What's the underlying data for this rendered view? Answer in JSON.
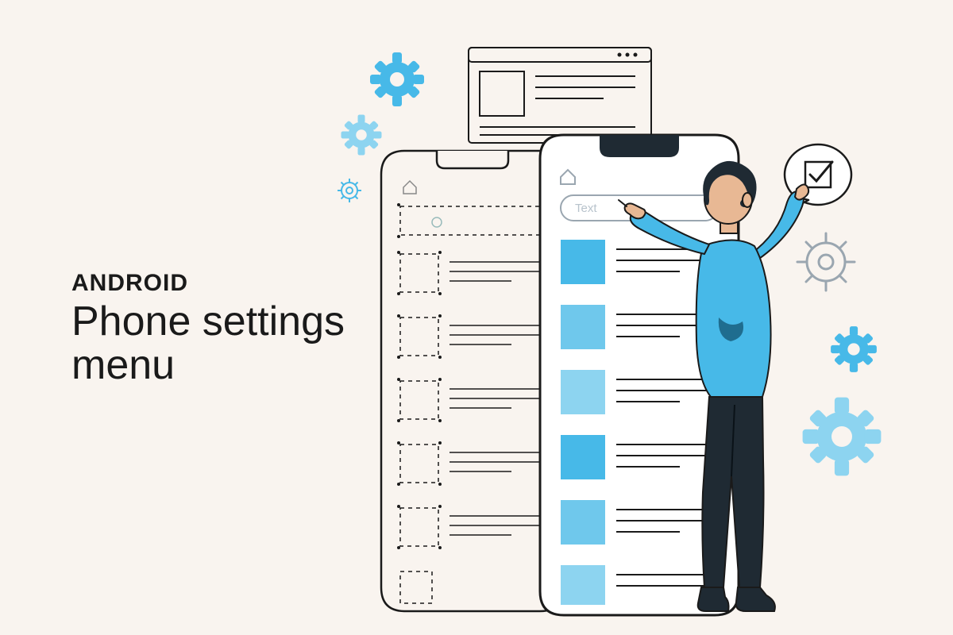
{
  "text": {
    "eyebrow": "ANDROID",
    "headline_line1": "Phone settings",
    "headline_line2": "menu"
  },
  "search": {
    "placeholder": "Text"
  },
  "colors": {
    "bg": "#f9f4ef",
    "accent1": "#47b9e8",
    "accent2": "#6fc8ec",
    "accent3": "#8dd4f0",
    "dark": "#1f2a33",
    "outline": "#1a1a1a"
  },
  "icons": {
    "gear": "gear-icon",
    "home": "home-icon",
    "check": "check-icon"
  }
}
